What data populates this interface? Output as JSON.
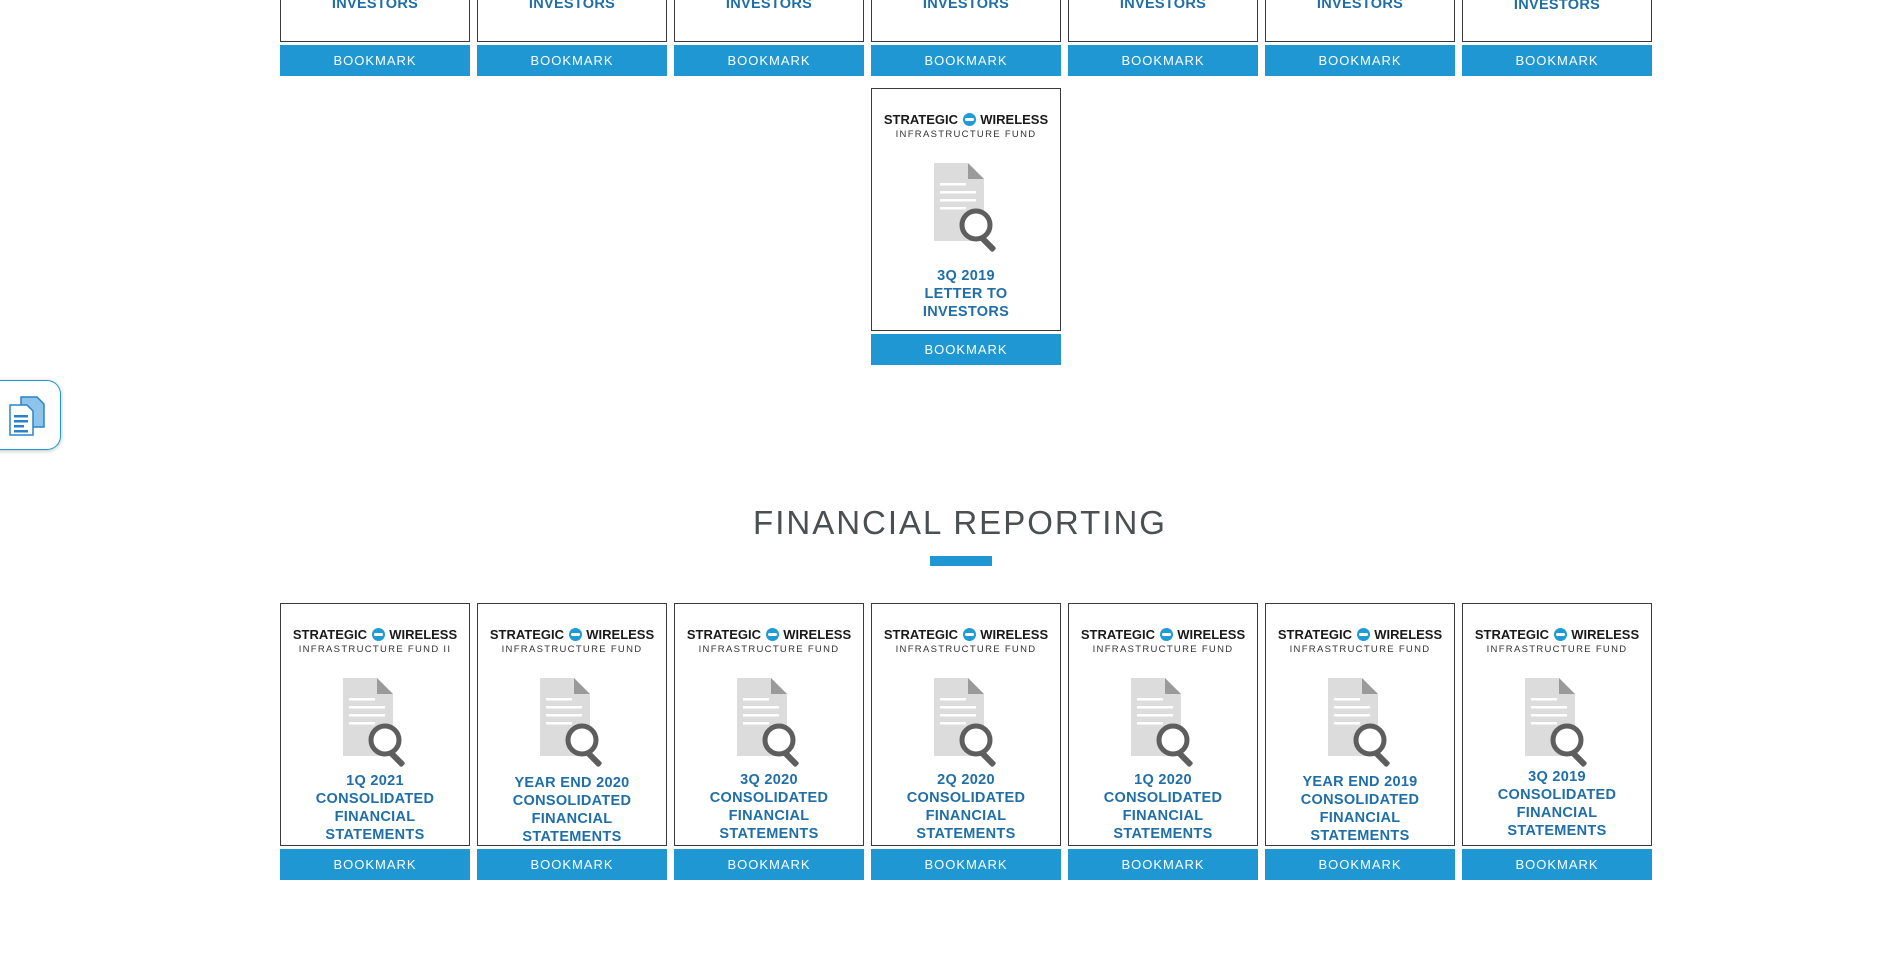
{
  "top_row": {
    "cards": [
      {
        "title": "LETTER TO\nINVESTORS",
        "bookmark": "BOOKMARK"
      },
      {
        "title": "LETTER TO\nINVESTORS",
        "bookmark": "BOOKMARK"
      },
      {
        "title": "LETTER TO\nINVESTORS",
        "bookmark": "BOOKMARK"
      },
      {
        "title": "LETTER TO\nINVESTORS",
        "bookmark": "BOOKMARK"
      },
      {
        "title": "LETTER TO\nINVESTORS",
        "bookmark": "BOOKMARK"
      },
      {
        "title": "LETTER TO\nINVESTORS",
        "bookmark": "BOOKMARK"
      },
      {
        "title": "LETTER TO\nINVESTORS",
        "bookmark": "BOOKMARK"
      }
    ]
  },
  "letters_last": {
    "logo_main_left": "STRATEGIC",
    "logo_main_right": "WIRELESS",
    "logo_sub": "INFRASTRUCTURE FUND",
    "title": "3Q 2019\nLETTER TO\nINVESTORS",
    "bookmark": "BOOKMARK"
  },
  "financial_reporting": {
    "heading": "FINANCIAL REPORTING",
    "cards": [
      {
        "logo_main_left": "STRATEGIC",
        "logo_main_right": "WIRELESS",
        "logo_sub": "INFRASTRUCTURE FUND II",
        "title": "1Q 2021\nCONSOLIDATED\nFINANCIAL\nSTATEMENTS",
        "bookmark": "BOOKMARK"
      },
      {
        "logo_main_left": "STRATEGIC",
        "logo_main_right": "WIRELESS",
        "logo_sub": "INFRASTRUCTURE FUND",
        "title": "YEAR END 2020\nCONSOLIDATED\nFINANCIAL\nSTATEMENTS",
        "bookmark": "BOOKMARK"
      },
      {
        "logo_main_left": "STRATEGIC",
        "logo_main_right": "WIRELESS",
        "logo_sub": "INFRASTRUCTURE FUND",
        "title": "3Q 2020\nCONSOLIDATED\nFINANCIAL\nSTATEMENTS",
        "bookmark": "BOOKMARK"
      },
      {
        "logo_main_left": "STRATEGIC",
        "logo_main_right": "WIRELESS",
        "logo_sub": "INFRASTRUCTURE FUND",
        "title": "2Q 2020\nCONSOLIDATED\nFINANCIAL\nSTATEMENTS",
        "bookmark": "BOOKMARK"
      },
      {
        "logo_main_left": "STRATEGIC",
        "logo_main_right": "WIRELESS",
        "logo_sub": "INFRASTRUCTURE FUND",
        "title": "1Q 2020\nCONSOLIDATED\nFINANCIAL\nSTATEMENTS",
        "bookmark": "BOOKMARK"
      },
      {
        "logo_main_left": "STRATEGIC",
        "logo_main_right": "WIRELESS",
        "logo_sub": "INFRASTRUCTURE FUND",
        "title": "YEAR END 2019\nCONSOLIDATED\nFINANCIAL\nSTATEMENTS",
        "bookmark": "BOOKMARK"
      },
      {
        "logo_main_left": "STRATEGIC",
        "logo_main_right": "WIRELESS",
        "logo_sub": "INFRASTRUCTURE FUND",
        "title": "3Q 2019\nCONSOLIDATED\nFINANCIAL\nSTATEMENTS",
        "bookmark": "BOOKMARK"
      }
    ]
  },
  "icons": {
    "document": "document-search-icon",
    "floating": "documents-icon",
    "logo_globe": "globe-logo-icon"
  },
  "colors": {
    "accent": "#1e97d2",
    "title_blue": "#1f6ea8",
    "heading_gray": "#4a4f52"
  }
}
